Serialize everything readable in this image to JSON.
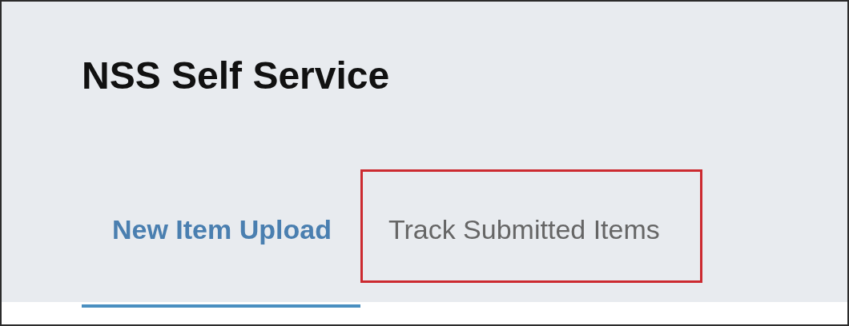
{
  "header": {
    "title": "NSS Self Service"
  },
  "tabs": [
    {
      "label": "New Item Upload",
      "selected": true,
      "highlighted": false
    },
    {
      "label": "Track Submitted Items",
      "selected": false,
      "highlighted": true
    }
  ]
}
